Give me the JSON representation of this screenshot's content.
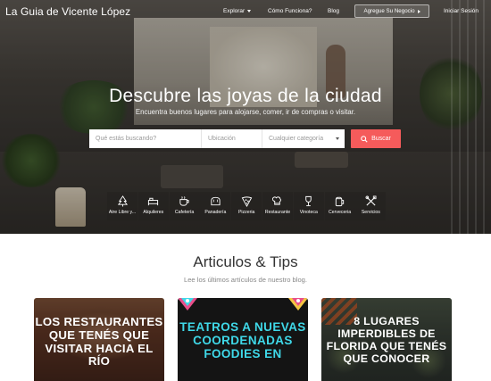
{
  "nav": {
    "brand": "La Guia de Vicente López",
    "explorar": "Explorar",
    "como_funciona": "Cómo Funciona?",
    "blog": "Blog",
    "agregue": "Agregue Su Negocio",
    "login": "Iniciar Sesión"
  },
  "hero": {
    "title": "Descubre las joyas de la ciudad",
    "subtitle": "Encuentra buenos lugares para alojarse, comer, ir de compras o visitar."
  },
  "search": {
    "what_placeholder": "Qué estás buscando?",
    "where_placeholder": "Ubicación",
    "category_selected": "Cualquier categoría",
    "button": "Buscar"
  },
  "categories": [
    {
      "label": "Aire Libre y...",
      "icon": "tree-icon"
    },
    {
      "label": "Alquileres",
      "icon": "bed-icon"
    },
    {
      "label": "Cafetería",
      "icon": "coffee-cup-icon"
    },
    {
      "label": "Panadería",
      "icon": "bread-icon"
    },
    {
      "label": "Pizzeria",
      "icon": "pizza-slice-icon"
    },
    {
      "label": "Restaurante",
      "icon": "chef-icon"
    },
    {
      "label": "Vinoteca",
      "icon": "wine-glass-icon"
    },
    {
      "label": "Cerveceria",
      "icon": "beer-mug-icon"
    },
    {
      "label": "Servicios",
      "icon": "tools-icon"
    }
  ],
  "articles": {
    "title": "Articulos & Tips",
    "subtitle": "Lee los últimos artículos de nuestro blog.",
    "cards": [
      {
        "title": "LOS RESTAURANTES QUE TENÉS QUE VISITAR HACIA EL RÍO"
      },
      {
        "title": "TEATROS A NUEVAS COORDENADAS FOODIES EN"
      },
      {
        "title": "8 LUGARES IMPERDIBLES DE FLORIDA QUE TENÉS QUE CONOCER"
      }
    ]
  },
  "colors": {
    "accent": "#f55b5b",
    "card2_title": "#3fd8e8"
  }
}
